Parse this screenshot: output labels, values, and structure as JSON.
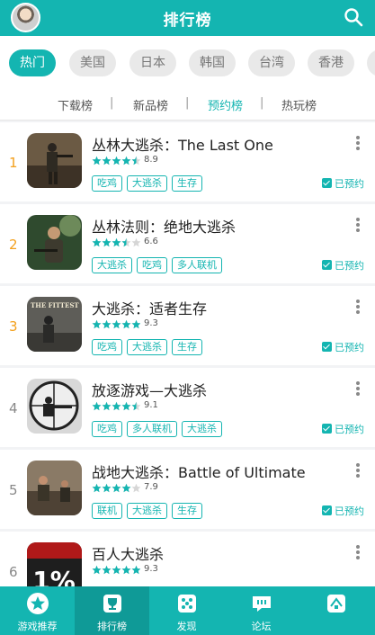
{
  "header": {
    "title": "排行榜"
  },
  "region_tabs": [
    {
      "label": "热门"
    },
    {
      "label": "美国"
    },
    {
      "label": "日本"
    },
    {
      "label": "韩国"
    },
    {
      "label": "台湾"
    },
    {
      "label": "香港"
    }
  ],
  "sub_tabs": [
    {
      "label": "下载榜"
    },
    {
      "label": "新品榜"
    },
    {
      "label": "预约榜"
    },
    {
      "label": "热玩榜"
    }
  ],
  "separator": "|",
  "booked_label": "已预约",
  "games": [
    {
      "rank": "1",
      "name": "丛林大逃杀：The Last One",
      "rating": "8.9",
      "stars": 4.5,
      "tags": [
        "吃鸡",
        "大逃杀",
        "生存"
      ]
    },
    {
      "rank": "2",
      "name": "丛林法则：绝地大逃杀",
      "rating": "6.6",
      "stars": 3.5,
      "tags": [
        "大逃杀",
        "吃鸡",
        "多人联机"
      ]
    },
    {
      "rank": "3",
      "name": "大逃杀：适者生存",
      "rating": "9.3",
      "stars": 5,
      "tags": [
        "吃鸡",
        "大逃杀",
        "生存"
      ]
    },
    {
      "rank": "4",
      "name": "放逐游戏—大逃杀",
      "rating": "9.1",
      "stars": 4.5,
      "tags": [
        "吃鸡",
        "多人联机",
        "大逃杀"
      ]
    },
    {
      "rank": "5",
      "name": "战地大逃杀：Battle of Ultimate",
      "rating": "7.9",
      "stars": 4,
      "tags": [
        "联机",
        "大逃杀",
        "生存"
      ]
    },
    {
      "rank": "6",
      "name": "百人大逃杀",
      "rating": "9.3",
      "stars": 5,
      "tags": []
    }
  ],
  "icon_texts": {
    "game3": "THE FITTEST",
    "game6": "1%"
  },
  "bottom_nav": [
    {
      "label": "游戏推荐",
      "icon": "star-icon"
    },
    {
      "label": "排行榜",
      "icon": "trophy-icon"
    },
    {
      "label": "发现",
      "icon": "discover-icon"
    },
    {
      "label": "论坛",
      "icon": "forum-icon"
    },
    {
      "label": "",
      "icon": "game-icon"
    }
  ],
  "colors": {
    "accent": "#14b5b1",
    "rank_top": "#f3a01d"
  }
}
